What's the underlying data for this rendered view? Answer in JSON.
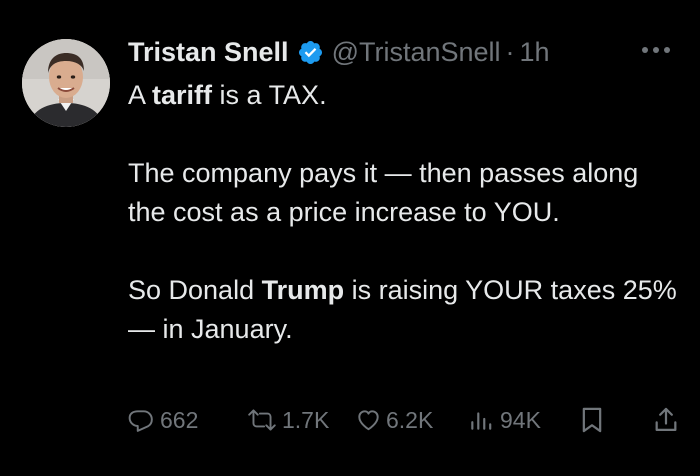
{
  "tweet": {
    "author": {
      "display_name": "Tristan Snell",
      "handle": "@TristanSnell",
      "verified": true,
      "verified_color": "#1d9bf0"
    },
    "separator": "·",
    "time": "1h",
    "body": {
      "p1": {
        "t1": "A ",
        "b1": "tariff",
        "t2": " is a TAX."
      },
      "p2": "The company pays it — then passes along the cost as a price increase to YOU.",
      "p3": {
        "t1": "So Donald ",
        "b1": "Trump",
        "t2": " is raising YOUR taxes 25% — in January."
      }
    },
    "actions": {
      "reply": {
        "icon": "reply-icon",
        "count": "662"
      },
      "retweet": {
        "icon": "retweet-icon",
        "count": "1.7K"
      },
      "like": {
        "icon": "heart-icon",
        "count": "6.2K"
      },
      "views": {
        "icon": "views-chart-icon",
        "count": "94K"
      },
      "bookmark": {
        "icon": "bookmark-icon"
      },
      "share": {
        "icon": "share-icon"
      }
    },
    "colors": {
      "background": "#000000",
      "text": "#e7e9ea",
      "secondary": "#71767b"
    }
  }
}
